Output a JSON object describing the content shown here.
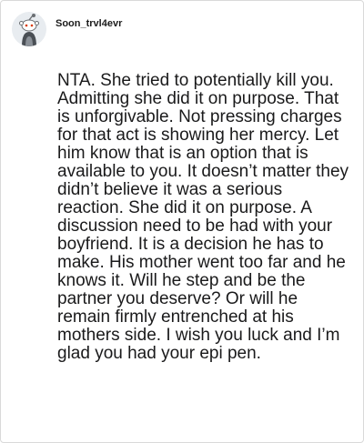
{
  "comment": {
    "username": "Soon_trvl4evr",
    "avatar_icon": "reddit-snoo-avatar-icon",
    "body": "NTA. She tried to potentially kill you. Admitting she did it on purpose. That is unforgivable. Not pressing charges for that act is showing her mercy. Let him know that is an option that is available to you. It doesn’t matter they didn’t believe it was a serious reaction. She did it on purpose. A discussion need to be had with your boyfriend. It is a decision he has to make. His mother went too far and he knows it. Will he step and be the partner you deserve? Or will he remain firmly entrenched at his mothers side. I wish you luck and I’m glad you had your epi pen."
  },
  "colors": {
    "background": "#ffffff",
    "border": "#d9d9d9",
    "text": "#1a1a1b",
    "avatar_bg": "#e8ecf0"
  }
}
